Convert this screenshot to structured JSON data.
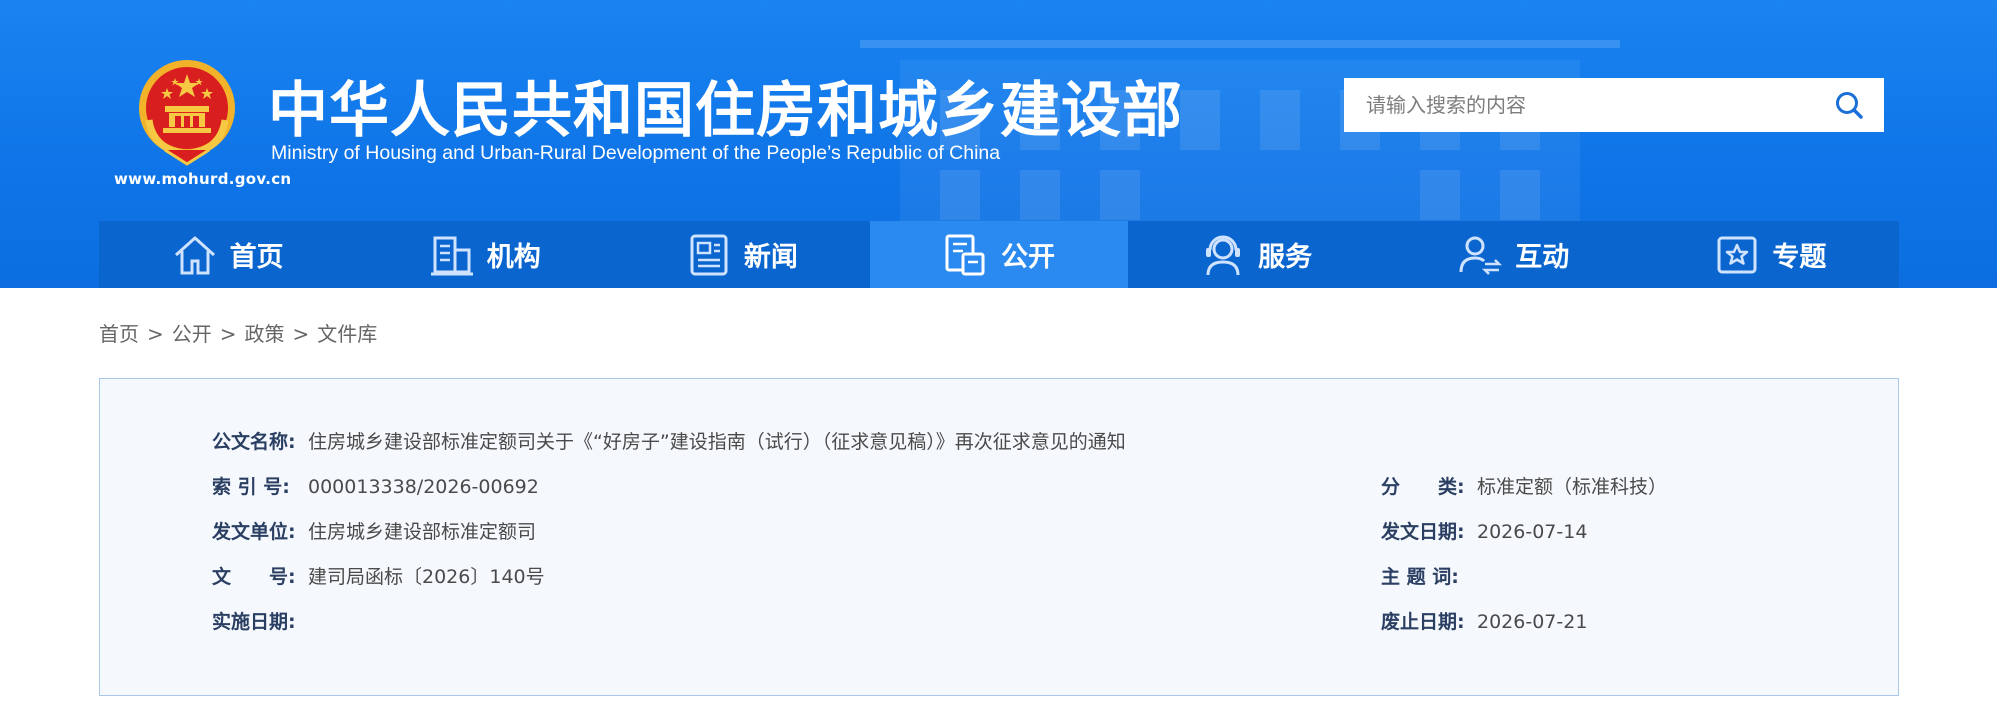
{
  "header": {
    "site_url": "www.mohurd.gov.cn",
    "title_cn": "中华人民共和国住房和城乡建设部",
    "title_en": "Ministry of Housing and Urban-Rural Development of the People’s Republic of China",
    "emblem_icon": "national-emblem-icon"
  },
  "search": {
    "placeholder": "请输入搜索的内容",
    "value": "",
    "icon": "search-icon"
  },
  "nav": {
    "items": [
      {
        "label": "首页",
        "icon": "home-icon"
      },
      {
        "label": "机构",
        "icon": "building-icon"
      },
      {
        "label": "新闻",
        "icon": "news-icon"
      },
      {
        "label": "公开",
        "icon": "document-icon",
        "active": true
      },
      {
        "label": "服务",
        "icon": "service-agent-icon"
      },
      {
        "label": "互动",
        "icon": "interact-user-icon"
      },
      {
        "label": "专题",
        "icon": "star-topic-icon"
      }
    ]
  },
  "breadcrumb": {
    "items": [
      "首页",
      "公开",
      "政策",
      "文件库"
    ],
    "separator": ">"
  },
  "document": {
    "name_label": "公文名称:",
    "name_value": "住房城乡建设部标准定额司关于《“好房子”建设指南（试行）（征求意见稿）》再次征求意见的通知",
    "index_label": "索 引 号:",
    "index_value": "000013338/2026-00692",
    "category_label": "分　　类:",
    "category_value": "标准定额（标准科技）",
    "issuer_label": "发文单位:",
    "issuer_value": "住房城乡建设部标准定额司",
    "date_label": "发文日期:",
    "date_value": "2026-07-14",
    "doc_no_label": "文　　号:",
    "doc_no_value": "建司局函标〔2026〕140号",
    "keywords_label": "主 题 词:",
    "keywords_value": "",
    "effective_label": "实施日期:",
    "effective_value": "",
    "expiry_label": "废止日期:",
    "expiry_value": "2026-07-21"
  },
  "colors": {
    "header_blue": "#1a84f0",
    "nav_blue": "#0b65cf",
    "nav_active": "#2a8af0",
    "label_navy": "#2b3f63",
    "panel_bg": "#f5f9fd",
    "panel_border": "#a9c7e8"
  }
}
